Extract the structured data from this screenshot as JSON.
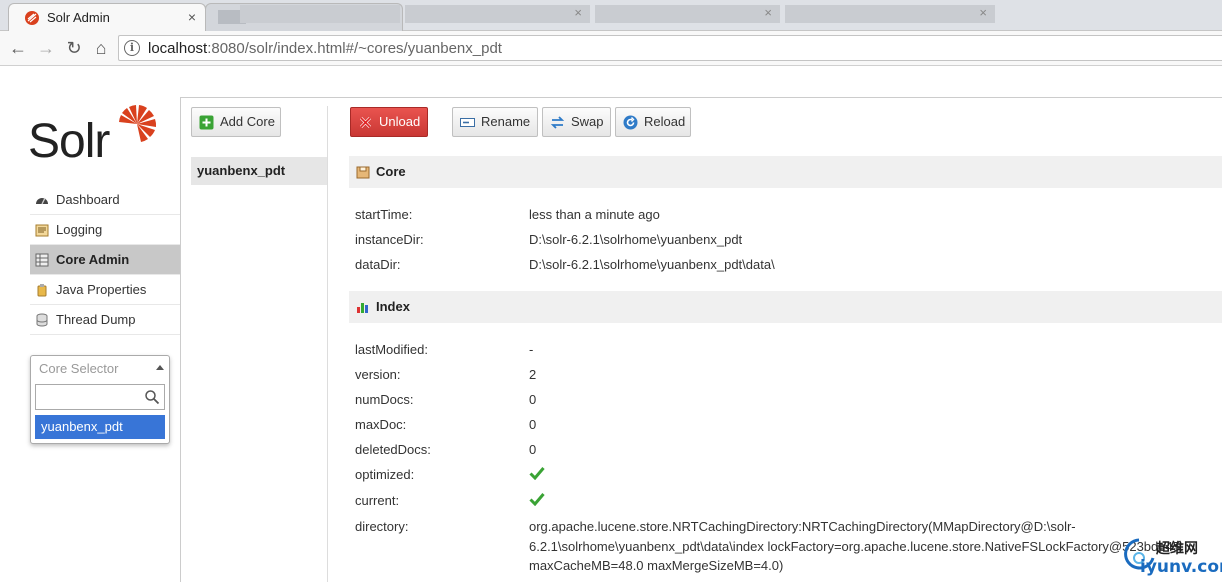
{
  "browser": {
    "tabs": [
      {
        "title": "Solr Admin",
        "active": true
      },
      {
        "title": "",
        "active": false
      }
    ],
    "close_glyph": "×",
    "url_host": "localhost",
    "url_rest": ":8080/solr/index.html#/~cores/yuanbenx_pdt"
  },
  "sidebar": {
    "logo_text": "Solr",
    "nav": [
      {
        "label": "Dashboard",
        "icon": "dashboard-icon"
      },
      {
        "label": "Logging",
        "icon": "logging-icon"
      },
      {
        "label": "Core Admin",
        "icon": "core-admin-icon",
        "active": true
      },
      {
        "label": "Java Properties",
        "icon": "java-properties-icon"
      },
      {
        "label": "Thread Dump",
        "icon": "thread-dump-icon"
      }
    ],
    "core_selector": {
      "label": "Core Selector",
      "search_value": "",
      "option": "yuanbenx_pdt"
    }
  },
  "cores": {
    "add_core_label": "Add Core",
    "items": [
      "yuanbenx_pdt"
    ]
  },
  "actions": {
    "unload": "Unload",
    "rename": "Rename",
    "swap": "Swap",
    "reload": "Reload"
  },
  "core_section": {
    "title": "Core",
    "rows": [
      {
        "key": "startTime:",
        "value": "less than a minute ago"
      },
      {
        "key": "instanceDir:",
        "value": "D:\\solr-6.2.1\\solrhome\\yuanbenx_pdt"
      },
      {
        "key": "dataDir:",
        "value": "D:\\solr-6.2.1\\solrhome\\yuanbenx_pdt\\data\\"
      }
    ]
  },
  "index_section": {
    "title": "Index",
    "rows": [
      {
        "key": "lastModified:",
        "value": "-"
      },
      {
        "key": "version:",
        "value": "2"
      },
      {
        "key": "numDocs:",
        "value": "0"
      },
      {
        "key": "maxDoc:",
        "value": "0"
      },
      {
        "key": "deletedDocs:",
        "value": "0"
      },
      {
        "key": "optimized:",
        "value": true
      },
      {
        "key": "current:",
        "value": true
      }
    ],
    "directory_key": "directory:",
    "directory_lines": [
      "org.apache.lucene.store.NRTCachingDirectory:NRTCachingDirectory(MMapDirectory@D:\\solr-",
      "6.2.1\\solrhome\\yuanbenx_pdt\\data\\index lockFactory=org.apache.lucene.store.NativeFSLockFactory@523bde45;",
      "maxCacheMB=48.0 maxMergeSizeMB=4.0)"
    ]
  },
  "watermark": {
    "cn": "超维网",
    "en": "iyunv.com"
  },
  "colors": {
    "accent_red": "#d9411e",
    "select_blue": "#3875d7",
    "check_green": "#3aa335"
  }
}
